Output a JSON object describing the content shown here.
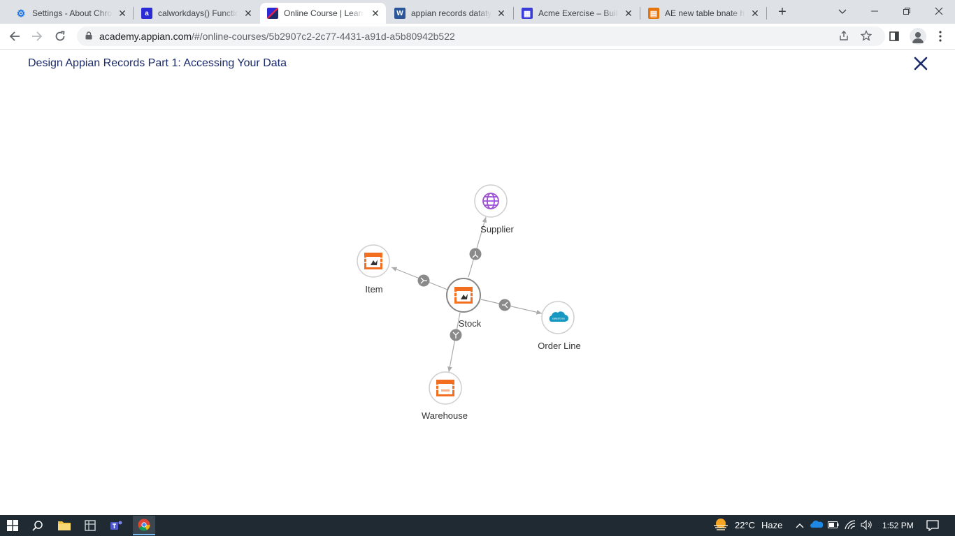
{
  "browser": {
    "tabs": [
      {
        "title": "Settings - About Chrome",
        "favicon": "gear-icon",
        "color": "#1a73e8",
        "glyph": "⚙"
      },
      {
        "title": "calworkdays() Function",
        "favicon": "appian-a-icon",
        "color": "#2b2bd6",
        "glyph": "a"
      },
      {
        "title": "Online Course | Learning",
        "favicon": "appian-academy-icon",
        "color": "#1b2a6b",
        "glyph": "/"
      },
      {
        "title": "appian records datatype",
        "favicon": "word-icon",
        "color": "#2b579a",
        "glyph": "W"
      },
      {
        "title": "Acme Exercise – Build",
        "favicon": "grid-app-icon",
        "color": "#3b3bd9",
        "glyph": "▦"
      },
      {
        "title": "AE new table bnate hr",
        "favicon": "table-app-icon",
        "color": "#e8740c",
        "glyph": "▤"
      }
    ],
    "active_tab": 2,
    "url_host": "academy.appian.com",
    "url_path": "/#/online-courses/5b2907c2-2c77-4431-a91d-a5b80942b522"
  },
  "page": {
    "title": "Design Appian Records Part 1: Accessing Your Data",
    "accent": "#1b2a6b"
  },
  "graph": {
    "nodes": [
      {
        "id": "supplier",
        "label": "Supplier",
        "icon": "globe-icon"
      },
      {
        "id": "item",
        "label": "Item",
        "icon": "database-icon"
      },
      {
        "id": "stock",
        "label": "Stock",
        "icon": "database-icon"
      },
      {
        "id": "orderline",
        "label": "Order Line",
        "icon": "salesforce-icon",
        "icon_text": "salesforce"
      },
      {
        "id": "warehouse",
        "label": "Warehouse",
        "icon": "database-icon"
      }
    ],
    "edges": [
      {
        "from": "stock",
        "to": "supplier",
        "type": "many-to-one"
      },
      {
        "from": "stock",
        "to": "item",
        "type": "many-to-one"
      },
      {
        "from": "stock",
        "to": "orderline",
        "type": "one-to-many"
      },
      {
        "from": "stock",
        "to": "warehouse",
        "type": "many-to-one"
      }
    ],
    "colors": {
      "record": "#f26f21",
      "globe": "#9b4fd6",
      "salesforce": "#1798c1",
      "edge": "#aaaaaa",
      "badge": "#8a8a8a"
    }
  },
  "taskbar": {
    "weather_temp": "22°C",
    "weather_desc": "Haze",
    "time": "1:52 PM"
  }
}
